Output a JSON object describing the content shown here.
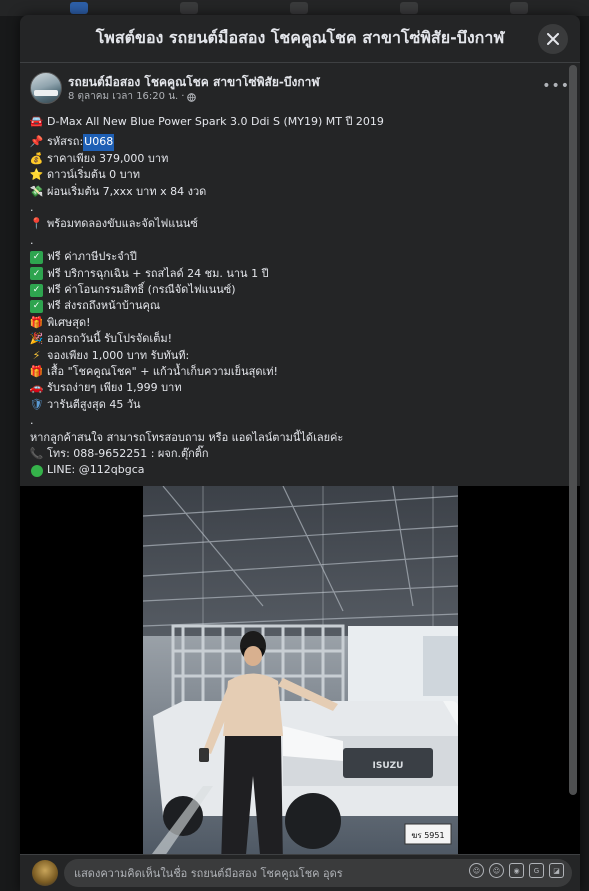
{
  "modal": {
    "title": "โพสต์ของ รถยนต์มือสอง โชคคูณโชค สาขาโซ่พิสัย-บึงกาฬ"
  },
  "post": {
    "page_name": "รถยนต์มือสอง โชคคูณโชค สาขาโซ่พิสัย-บึงกาฬ",
    "time": "8 ตุลาคม เวลา 16:20 น.",
    "time_sep": "·",
    "more": "•••",
    "headline": "D-Max All New Blue Power Spark 3.0 Ddi S (MY19) MT ปี 2019",
    "code_label": "รหัสรถ:",
    "code_value": "U068",
    "price": "ราคาเพียง 379,000 บาท",
    "down": "ดาวน์เริ่มต้น 0 บาท",
    "installment": "ผ่อนเริ่มต้น 7,xxx บาท x 84 งวด",
    "dot1": ".",
    "testdrive": "พร้อมทดลองขับและจัดไฟแนนซ์",
    "dot2": ".",
    "free1": "ฟรี ค่าภาษีประจำปี",
    "free2": "ฟรี บริการฉุกเฉิน + รถสไลด์ 24 ชม. นาน 1 ปี",
    "free3": "ฟรี ค่าโอนกรรมสิทธิ์ (กรณีจัดไฟแนนซ์)",
    "free4": "ฟรี ส่งรถถึงหน้าบ้านคุณ",
    "special": "พิเศษสุด!",
    "today": "ออกรถวันนี้ รับโปรจัดเต็ม!",
    "booking": "จองเพียง 1,000 บาท รับทันที:",
    "shirt": "เสื้อ \"โชคคูณโชค\" + แก้วน้ำเก็บความเย็นสุดเท่!",
    "pickup": "รับรถง่ายๆ เพียง 1,999 บาท",
    "warranty": "วารันตีสูงสุด 45 วัน",
    "dot3": ".",
    "contact": "หากลูกค้าสนใจ สามารถโทรสอบถาม หรือ แอดไลน์ตามนี้ได้เลยค่ะ",
    "phone": "โทร: 088-9652251 : ผจก.ตุ๊กติ๊ก",
    "line": "LINE: @112qbgca"
  },
  "photo": {
    "plate": "ฆร 5951",
    "badge": "ISUZU"
  },
  "comment": {
    "placeholder": "แสดงความคิดเห็นในชื่อ รถยนต์มือสอง โชคคูณโชค อุดร",
    "icons": [
      "avatar-icon",
      "smile-icon",
      "camera-icon",
      "gif-icon",
      "sticker-icon"
    ]
  },
  "colors": {
    "background": "#18191a",
    "surface": "#242526",
    "highlight": "#1e5fb4",
    "check": "#2ea44f"
  }
}
